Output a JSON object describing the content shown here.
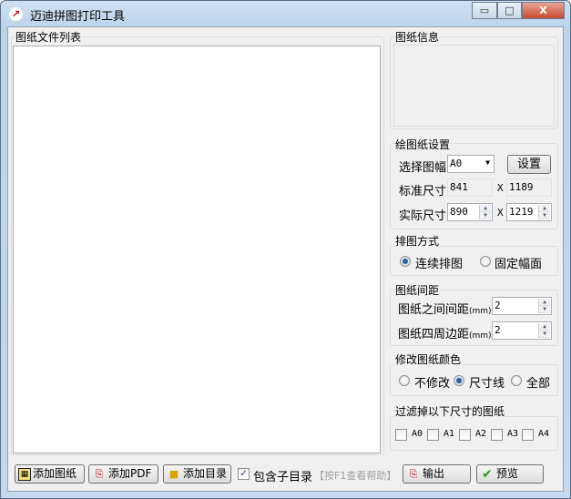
{
  "window": {
    "title": "迈迪拼图打印工具",
    "minimize": "▭",
    "maximize": "□",
    "close": "X"
  },
  "file_list": {
    "label": "图纸文件列表"
  },
  "info": {
    "label": "图纸信息"
  },
  "draw_settings": {
    "label": "绘图纸设置",
    "size_label": "选择图幅",
    "size_value": "A0",
    "set_button": "设置",
    "std_label": "标准尺寸",
    "std_w": "841",
    "std_h": "1189",
    "x": "X",
    "actual_label": "实际尺寸",
    "actual_w": "890",
    "actual_h": "1219"
  },
  "layout": {
    "label": "排图方式",
    "options": [
      "连续排图",
      "固定幅面"
    ],
    "selected": 0
  },
  "spacing": {
    "label": "图纸间距",
    "between_label": "图纸之间间距",
    "between_value": "2",
    "margin_label": "图纸四周边距",
    "margin_value": "2",
    "unit": "(mm)"
  },
  "color": {
    "label": "修改图纸颜色",
    "options": [
      "不修改",
      "尺寸线",
      "全部"
    ],
    "selected": 1
  },
  "filter": {
    "label": "过滤掉以下尺寸的图纸",
    "options": [
      "A0",
      "A1",
      "A2",
      "A3",
      "A4"
    ]
  },
  "bottom": {
    "add_drawing": "添加图纸",
    "add_pdf": "添加PDF",
    "add_dir": "添加目录",
    "include_sub": "包含子目录",
    "include_sub_checked": true,
    "help": "【按F1查看帮助】",
    "output": "输出",
    "preview": "预览"
  }
}
